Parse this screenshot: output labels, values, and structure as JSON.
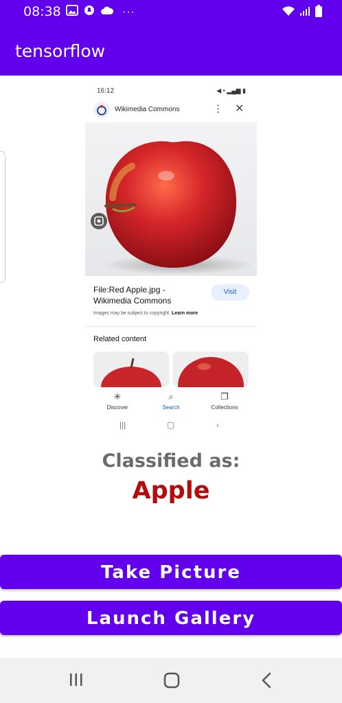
{
  "status_bar": {
    "time": "08:38",
    "left_icons": [
      "image-icon",
      "notification-icon",
      "cloud-icon"
    ],
    "more": "···",
    "right_icons": [
      "wifi-icon",
      "signal-icon",
      "battery-icon"
    ]
  },
  "app_bar": {
    "title": "tensorflow"
  },
  "image": {
    "status_time": "16:12",
    "status_right": "◀ • ▂▄▆ ▮",
    "source_title": "Wikimedia Commons",
    "caption": "File:Red Apple.jpg - Wikimedia Commons",
    "visit_label": "Visit",
    "copyright_text": "Images may be subject to copyright.",
    "learn_more": "Learn more",
    "related_heading": "Related content",
    "nav": [
      {
        "label": "Discover",
        "icon": "asterisk-icon"
      },
      {
        "label": "Search",
        "icon": "search-icon"
      },
      {
        "label": "Collections",
        "icon": "collections-icon"
      }
    ],
    "photo_subject": "red apple"
  },
  "classification": {
    "heading": "Classified as:",
    "result": "Apple",
    "result_color": "#b30c0c"
  },
  "buttons": {
    "take_picture": "Take Picture",
    "launch_gallery": "Launch Gallery"
  },
  "colors": {
    "primary": "#6200ee"
  }
}
